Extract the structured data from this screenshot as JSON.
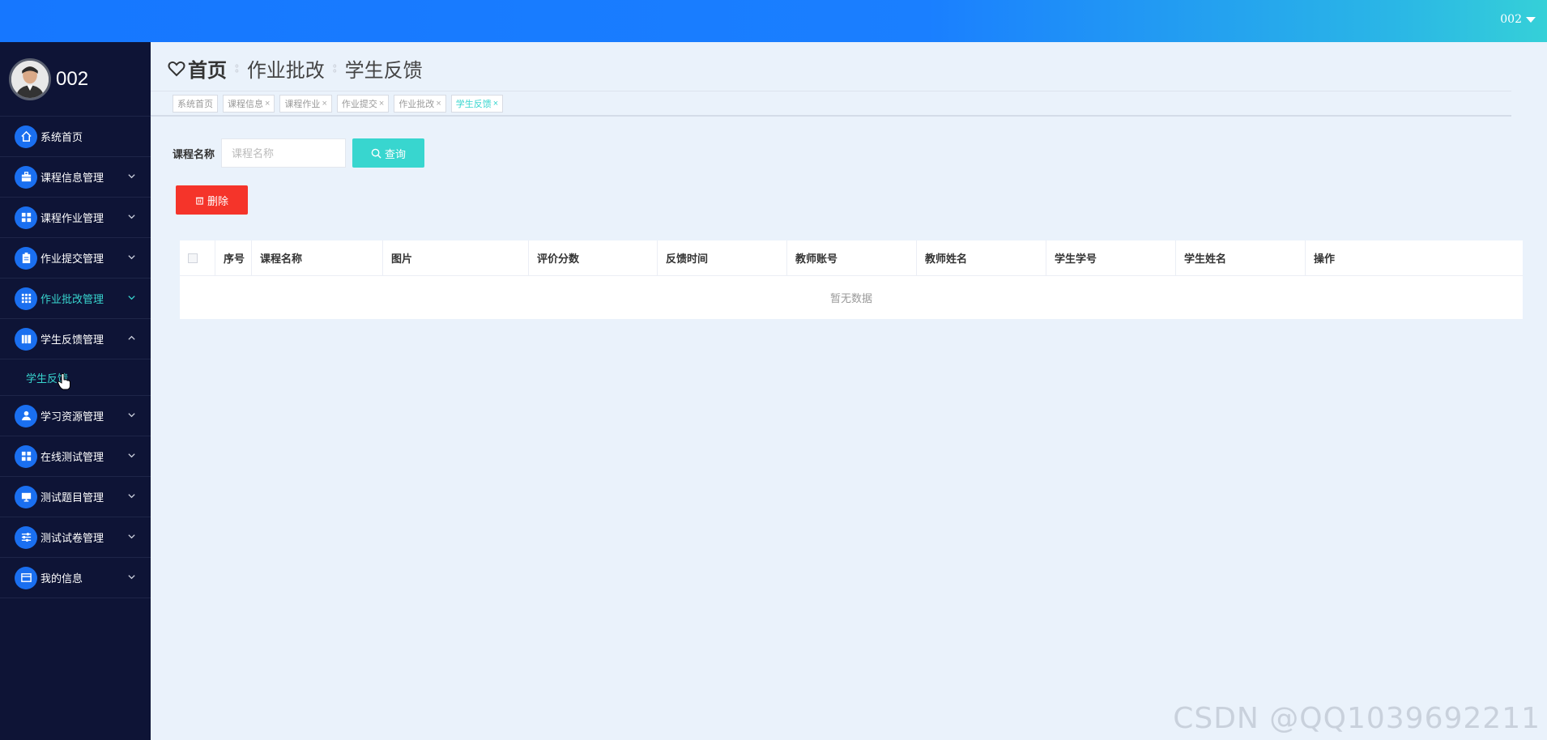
{
  "header": {
    "user": "002"
  },
  "sidebar": {
    "profile": {
      "name": "002"
    },
    "items": [
      {
        "label": "系统首页",
        "icon": "home-icon"
      },
      {
        "label": "课程信息管理",
        "icon": "briefcase-icon"
      },
      {
        "label": "课程作业管理",
        "icon": "grid-icon"
      },
      {
        "label": "作业提交管理",
        "icon": "clipboard-icon"
      },
      {
        "label": "作业批改管理",
        "icon": "dots-grid-icon"
      },
      {
        "label": "学生反馈管理",
        "icon": "books-icon"
      },
      {
        "label": "学习资源管理",
        "icon": "user-icon"
      },
      {
        "label": "在线测试管理",
        "icon": "grid-icon"
      },
      {
        "label": "测试题目管理",
        "icon": "monitor-icon"
      },
      {
        "label": "测试试卷管理",
        "icon": "sliders-icon"
      },
      {
        "label": "我的信息",
        "icon": "window-icon"
      }
    ],
    "submenu": {
      "label": "学生反馈"
    }
  },
  "breadcrumb": {
    "home": "首页",
    "items": [
      "作业批改",
      "学生反馈"
    ]
  },
  "tabs": [
    {
      "label": "系统首页"
    },
    {
      "label": "课程信息"
    },
    {
      "label": "课程作业"
    },
    {
      "label": "作业提交"
    },
    {
      "label": "作业批改"
    },
    {
      "label": "学生反馈"
    }
  ],
  "search": {
    "label": "课程名称",
    "placeholder": "课程名称",
    "value": "",
    "button": "查询"
  },
  "actions": {
    "delete": "删除"
  },
  "table": {
    "columns": [
      "序号",
      "课程名称",
      "图片",
      "评价分数",
      "反馈时间",
      "教师账号",
      "教师姓名",
      "学生学号",
      "学生姓名",
      "操作"
    ],
    "empty_text": "暂无数据"
  },
  "watermark": "CSDN @QQ1039692211",
  "colors": {
    "accent": "#38d6cf",
    "danger": "#f5342a",
    "primary": "#1a6ff0",
    "sidebar_bg": "#0e1436"
  }
}
